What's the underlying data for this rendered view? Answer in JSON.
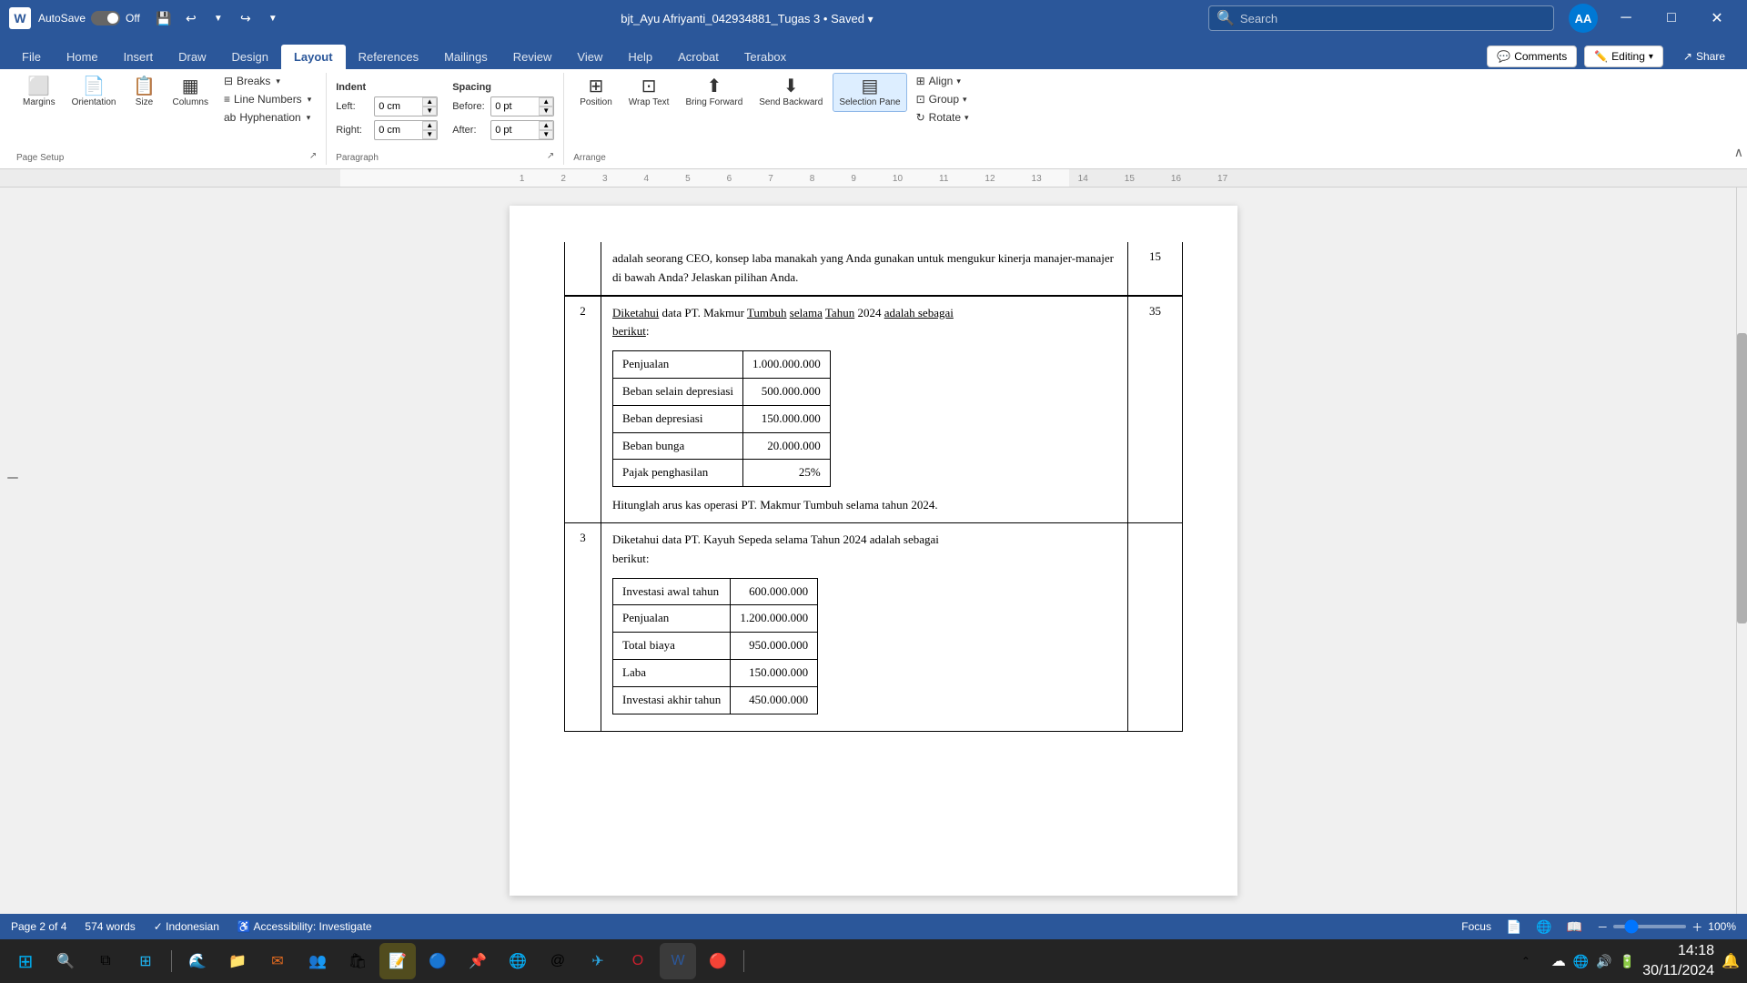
{
  "titleBar": {
    "logo": "W",
    "autosave": "AutoSave",
    "autosave_state": "Off",
    "filename": "bjt_Ayu Afriyanti_042934881_Tugas 3",
    "saved_state": "Saved",
    "search_placeholder": "Search"
  },
  "ribbonTabs": [
    {
      "label": "File",
      "active": false
    },
    {
      "label": "Home",
      "active": false
    },
    {
      "label": "Insert",
      "active": false
    },
    {
      "label": "Draw",
      "active": false
    },
    {
      "label": "Design",
      "active": false
    },
    {
      "label": "Layout",
      "active": true
    },
    {
      "label": "References",
      "active": false
    },
    {
      "label": "Mailings",
      "active": false
    },
    {
      "label": "Review",
      "active": false
    },
    {
      "label": "View",
      "active": false
    },
    {
      "label": "Help",
      "active": false
    },
    {
      "label": "Acrobat",
      "active": false
    },
    {
      "label": "Terabox",
      "active": false
    }
  ],
  "ribbon": {
    "pageSetup": {
      "label": "Page Setup",
      "margins_label": "Margins",
      "orientation_label": "Orientation",
      "size_label": "Size",
      "columns_label": "Columns",
      "breaks_label": "Breaks",
      "lineNumbers_label": "Line Numbers",
      "hyphenation_label": "Hyphenation"
    },
    "paragraph": {
      "label": "Paragraph",
      "indent_label": "Indent",
      "left_label": "Left:",
      "right_label": "Right:",
      "left_value": "0 cm",
      "right_value": "0 cm",
      "spacing_label": "Spacing",
      "before_label": "Before:",
      "after_label": "After:",
      "before_value": "0 pt",
      "after_value": "0 pt"
    },
    "arrange": {
      "label": "Arrange",
      "position_label": "Position",
      "wrapText_label": "Wrap Text",
      "bringForward_label": "Bring Forward",
      "sendBackward_label": "Send Backward",
      "selectionPane_label": "Selection Pane",
      "align_label": "Align",
      "group_label": "Group",
      "rotate_label": "Rotate"
    }
  },
  "header": {
    "comments_label": "Comments",
    "editing_label": "Editing",
    "share_label": "Share"
  },
  "document": {
    "intro_text": "adalah seorang CEO, konsep laba manakah yang Anda gunakan untuk mengukur kinerja manajer-manajer di bawah Anda? Jelaskan pilihan Anda.",
    "score1": "15",
    "q2_num": "2",
    "q2_text": "Diketahui data PT. Makmur Tumbuh selama Tahun 2024 adalah sebagai berikut:",
    "q2_table": [
      {
        "label": "Penjualan",
        "value": "1.000.000.000"
      },
      {
        "label": "Beban selain depresiasi",
        "value": "500.000.000"
      },
      {
        "label": "Beban depresiasi",
        "value": "150.000.000"
      },
      {
        "label": "Beban bunga",
        "value": "20.000.000"
      },
      {
        "label": "Pajak penghasilan",
        "value": "25%"
      }
    ],
    "q2_instruction": "Hitunglah arus kas operasi PT. Makmur Tumbuh selama tahun 2024.",
    "score2": "35",
    "q3_num": "3",
    "q3_text": "Diketahui data PT. Kayuh Sepeda selama Tahun 2024 adalah sebagai berikut:",
    "q3_table": [
      {
        "label": "Investasi awal tahun",
        "value": "600.000.000"
      },
      {
        "label": "Penjualan",
        "value": "1.200.000.000"
      },
      {
        "label": "Total biaya",
        "value": "950.000.000"
      },
      {
        "label": "Laba",
        "value": "150.000.000"
      },
      {
        "label": "Investasi akhir tahun",
        "value": "450.000.000"
      }
    ]
  },
  "statusBar": {
    "page": "Page 2 of 4",
    "words": "574 words",
    "language": "Indonesian",
    "accessibility": "Accessibility: Investigate",
    "focus": "Focus",
    "zoom": "100%"
  },
  "taskbar": {
    "time": "14:18",
    "date": "30/11/2024"
  }
}
